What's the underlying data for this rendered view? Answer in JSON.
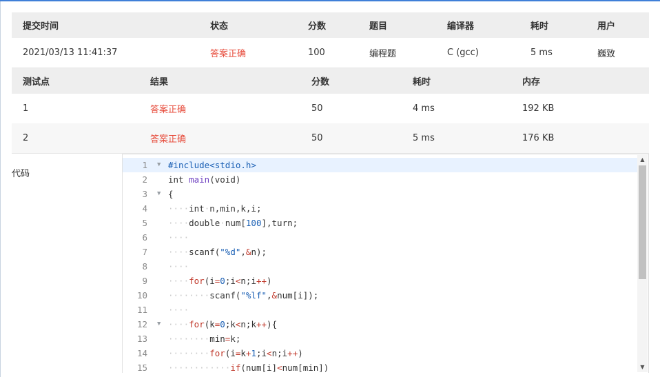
{
  "submission": {
    "headers": [
      "提交时间",
      "状态",
      "分数",
      "题目",
      "编译器",
      "耗时",
      "用户"
    ],
    "row": {
      "time": "2021/03/13 11:41:37",
      "status": "答案正确",
      "score": "100",
      "problem": "编程题",
      "compiler": "C (gcc)",
      "duration": "5 ms",
      "user": "巍致"
    }
  },
  "testcases": {
    "headers": [
      "测试点",
      "结果",
      "分数",
      "耗时",
      "内存"
    ],
    "rows": [
      {
        "id": "1",
        "result": "答案正确",
        "score": "50",
        "time": "4 ms",
        "memory": "192 KB"
      },
      {
        "id": "2",
        "result": "答案正确",
        "score": "50",
        "time": "5 ms",
        "memory": "176 KB"
      }
    ]
  },
  "code": {
    "label": "代码",
    "lines": [
      {
        "n": "1",
        "fold": true,
        "text": "#include<stdio.h>"
      },
      {
        "n": "2",
        "fold": false,
        "text": "int main(void)"
      },
      {
        "n": "3",
        "fold": true,
        "text": "{"
      },
      {
        "n": "4",
        "fold": false,
        "text": "····int·n,min,k,i;"
      },
      {
        "n": "5",
        "fold": false,
        "text": "····double·num[100],turn;"
      },
      {
        "n": "6",
        "fold": false,
        "text": "····"
      },
      {
        "n": "7",
        "fold": false,
        "text": "····scanf(\"%d\",&n);"
      },
      {
        "n": "8",
        "fold": false,
        "text": "····"
      },
      {
        "n": "9",
        "fold": false,
        "text": "····for(i=0;i<n;i++)"
      },
      {
        "n": "10",
        "fold": false,
        "text": "········scanf(\"%lf\",&num[i]);"
      },
      {
        "n": "11",
        "fold": false,
        "text": "····"
      },
      {
        "n": "12",
        "fold": true,
        "text": "····for(k=0;k<n;k++){"
      },
      {
        "n": "13",
        "fold": false,
        "text": "········min=k;"
      },
      {
        "n": "14",
        "fold": false,
        "text": "········for(i=k+1;i<n;i++)"
      },
      {
        "n": "15",
        "fold": false,
        "text": "············if(num[i]<num[min])"
      }
    ]
  },
  "icons": {
    "fold": "fold-arrow-icon",
    "scroll_up": "scroll-up-arrow-icon",
    "scroll_down": "scroll-down-arrow-icon"
  },
  "colors": {
    "accent": "#3f7fd8",
    "status_ok": "#e74c3c",
    "header_bg": "#eeeeee"
  }
}
